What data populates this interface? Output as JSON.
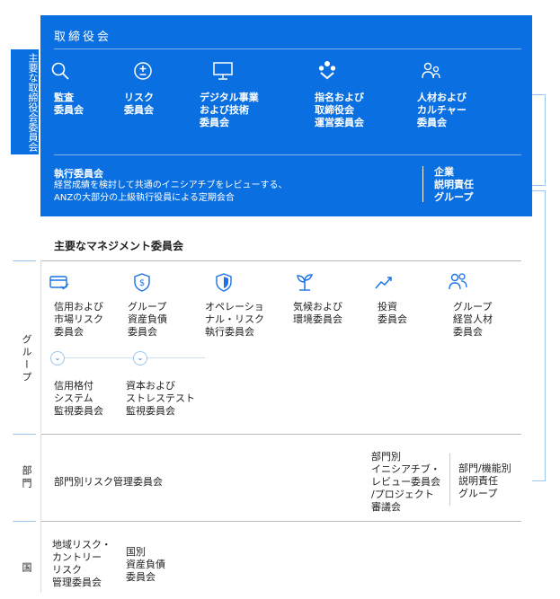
{
  "side_tag": "主要な取締役会委員会",
  "board": {
    "title": "取締役会",
    "committees": [
      {
        "label": "監査\n委員会",
        "icon": "search-icon"
      },
      {
        "label": "リスク\n委員会",
        "icon": "plus-minus-icon"
      },
      {
        "label": "デジタル事業\nおよび技術\n委員会",
        "icon": "monitor-icon"
      },
      {
        "label": "指名および\n取締役会\n運営委員会",
        "icon": "people-award-icon"
      },
      {
        "label": "人材および\nカルチャー\n委員会",
        "icon": "people-icon"
      }
    ],
    "exec_title": "執行委員会",
    "exec_desc": "経営成績を検討して共通のイニシアチブをレビューする、\nANZの大部分の上級執行役員による定期会合",
    "accountable": "企業\n説明責任\nグループ"
  },
  "management": {
    "title": "主要なマネジメント委員会",
    "group_label": "グループ",
    "group_items": [
      {
        "label": "信用および\n市場リスク\n委員会",
        "icon": "credit-card-check-icon"
      },
      {
        "label": "グループ\n資産負債\n委員会",
        "icon": "dollar-shield-icon"
      },
      {
        "label": "オペレーショ\nナル・リスク\n執行委員会",
        "icon": "shield-icon"
      },
      {
        "label": "気候および\n環境委員会",
        "icon": "sprout-icon"
      },
      {
        "label": "投資\n委員会",
        "icon": "trend-chart-icon"
      },
      {
        "label": "グループ\n経営人材\n委員会",
        "icon": "people-icon"
      }
    ],
    "sub_items": [
      {
        "label": "信用格付\nシステム\n監視委員会"
      },
      {
        "label": "資本および\nストレステスト\n監視委員会"
      }
    ],
    "division_label": "部門",
    "division_risk": "部門別リスク管理委員会",
    "division_initiative": "部門別\nイニシアチブ・\nレビュー委員会\n/プロジェクト\n審議会",
    "division_accountable": "部門/機能別\n説明責任\nグループ",
    "country_label": "国",
    "country_items": [
      {
        "label": "地域リスク・\nカントリー\nリスク\n管理委員会"
      },
      {
        "label": "国別\n資産負債\n委員会"
      }
    ]
  }
}
